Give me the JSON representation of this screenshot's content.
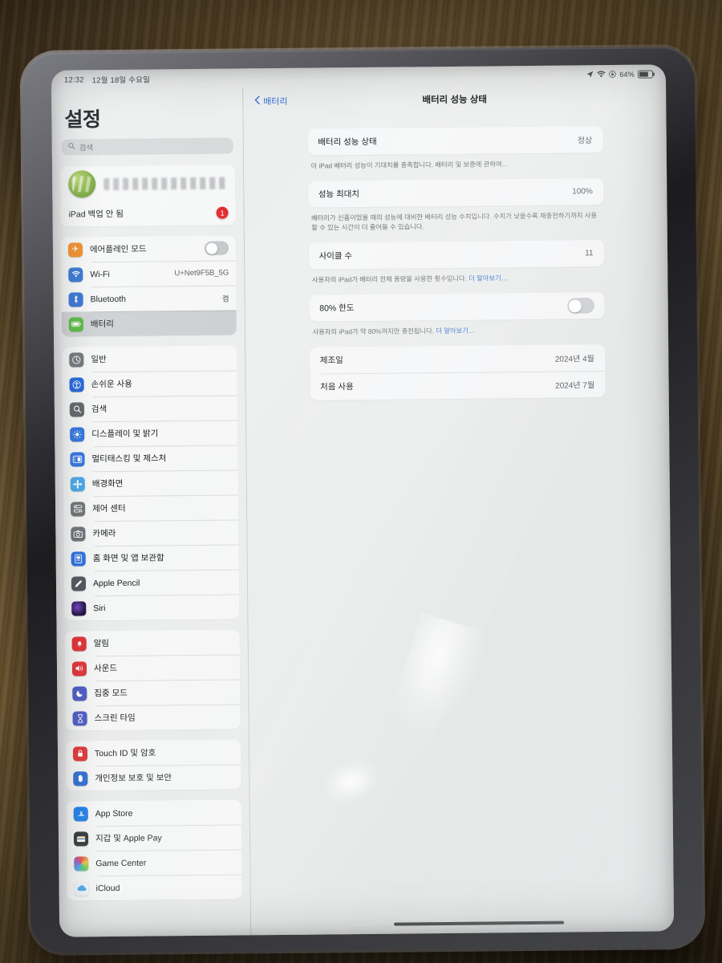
{
  "status_bar": {
    "time": "12:32",
    "date": "12월 18일 수요일",
    "location_icon": "location-arrow-icon",
    "wifi_icon": "wifi-icon",
    "orientation_lock_icon": "rotation-lock-icon",
    "battery_percent": "64%"
  },
  "sidebar": {
    "title": "설정",
    "search": {
      "placeholder": "검색",
      "icon": "search-icon"
    },
    "account": {
      "name_masked": "",
      "backup_label": "iPad 백업 안 됨",
      "badge_count": "1"
    },
    "groups": [
      {
        "items": [
          {
            "label": "에어플레인 모드",
            "icon": "airplane-icon",
            "color": "#f08a1e",
            "type": "toggle",
            "toggle_on": false
          },
          {
            "label": "Wi-Fi",
            "icon": "wifi-icon",
            "color": "#2f6fd0",
            "type": "value",
            "value": "U+Net9F5B_5G"
          },
          {
            "label": "Bluetooth",
            "icon": "bluetooth-icon",
            "color": "#2f6fd0",
            "type": "value",
            "value": "켬"
          },
          {
            "label": "배터리",
            "icon": "battery-icon",
            "color": "#53b93b",
            "type": "plain",
            "selected": true
          }
        ]
      },
      {
        "items": [
          {
            "label": "일반",
            "icon": "gear-icon",
            "color": "#6f7276",
            "type": "plain"
          },
          {
            "label": "손쉬운 사용",
            "icon": "accessibility-icon",
            "color": "#1f62d8",
            "type": "plain"
          },
          {
            "label": "검색",
            "icon": "search-icon",
            "color": "#5e6266",
            "type": "plain"
          },
          {
            "label": "디스플레이 및 밝기",
            "icon": "brightness-icon",
            "color": "#2f72e0",
            "type": "plain"
          },
          {
            "label": "멀티태스킹 및 제스처",
            "icon": "multitasking-icon",
            "color": "#2f72e0",
            "type": "plain"
          },
          {
            "label": "배경화면",
            "icon": "wallpaper-icon",
            "color": "#47a7e8",
            "type": "plain"
          },
          {
            "label": "제어 센터",
            "icon": "control-center-icon",
            "color": "#6f7276",
            "type": "plain"
          },
          {
            "label": "카메라",
            "icon": "camera-icon",
            "color": "#6f7276",
            "type": "plain"
          },
          {
            "label": "홈 화면 및 앱 보관함",
            "icon": "home-screen-icon",
            "color": "#2f72e0",
            "type": "plain"
          },
          {
            "label": "Apple Pencil",
            "icon": "pencil-icon",
            "color": "#55585c",
            "type": "plain"
          },
          {
            "label": "Siri",
            "icon": "siri-icon",
            "color": "#1a1a2b",
            "type": "plain"
          }
        ]
      },
      {
        "items": [
          {
            "label": "알림",
            "icon": "bell-icon",
            "color": "#e0373b",
            "type": "plain"
          },
          {
            "label": "사운드",
            "icon": "speaker-icon",
            "color": "#e0373b",
            "type": "plain"
          },
          {
            "label": "집중 모드",
            "icon": "moon-icon",
            "color": "#4f5ec4",
            "type": "plain"
          },
          {
            "label": "스크린 타임",
            "icon": "hourglass-icon",
            "color": "#4f5ec4",
            "type": "plain"
          }
        ]
      },
      {
        "items": [
          {
            "label": "Touch ID 및 암호",
            "icon": "lock-icon",
            "color": "#e0373b",
            "type": "plain"
          },
          {
            "label": "개인정보 보호 및 보안",
            "icon": "hand-icon",
            "color": "#2f6fd0",
            "type": "plain"
          }
        ]
      },
      {
        "items": [
          {
            "label": "App Store",
            "icon": "app-store-icon",
            "color": "#1d7ee8",
            "type": "plain"
          },
          {
            "label": "지갑 및 Apple Pay",
            "icon": "wallet-icon",
            "color": "#33363a",
            "type": "plain"
          },
          {
            "label": "Game Center",
            "icon": "game-center-icon",
            "color": "#8e5fd0",
            "type": "plain"
          },
          {
            "label": "iCloud",
            "icon": "icloud-icon",
            "color": "#4aa6e8",
            "type": "plain"
          }
        ]
      }
    ]
  },
  "detail": {
    "back_label": "배터리",
    "title": "배터리 성능 상태",
    "sections": [
      {
        "rows": [
          {
            "label": "배터리 성능 상태",
            "value": "정상",
            "type": "value"
          }
        ],
        "note_text": "이 iPad 배터리 성능이 기대치를 충족합니다. 배터리 및 보증에 관하여…",
        "note_link": ""
      },
      {
        "rows": [
          {
            "label": "성능 최대치",
            "value": "100%",
            "type": "value"
          }
        ],
        "note_text": "배터리가 신품이었을 때의 성능에 대비한 배터리 성능 수치입니다. 수치가 낮을수록 재충전하기까지 사용할 수 있는 시간이 더 줄어들 수 있습니다.",
        "note_link": ""
      },
      {
        "rows": [
          {
            "label": "사이클 수",
            "value": "11",
            "type": "value"
          }
        ],
        "note_text": "사용자의 iPad가 배터리 전체 용량을 사용한 횟수입니다. ",
        "note_link": "더 알아보기…"
      },
      {
        "rows": [
          {
            "label": "80% 한도",
            "value": "",
            "type": "toggle",
            "toggle_on": false
          }
        ],
        "note_text": "사용자의 iPad가 약 80%까지만 충전됩니다. ",
        "note_link": "더 알아보기…"
      },
      {
        "rows": [
          {
            "label": "제조일",
            "value": "2024년 4월",
            "type": "value"
          },
          {
            "label": "처음 사용",
            "value": "2024년 7월",
            "type": "value"
          }
        ],
        "note_text": "",
        "note_link": ""
      }
    ]
  }
}
